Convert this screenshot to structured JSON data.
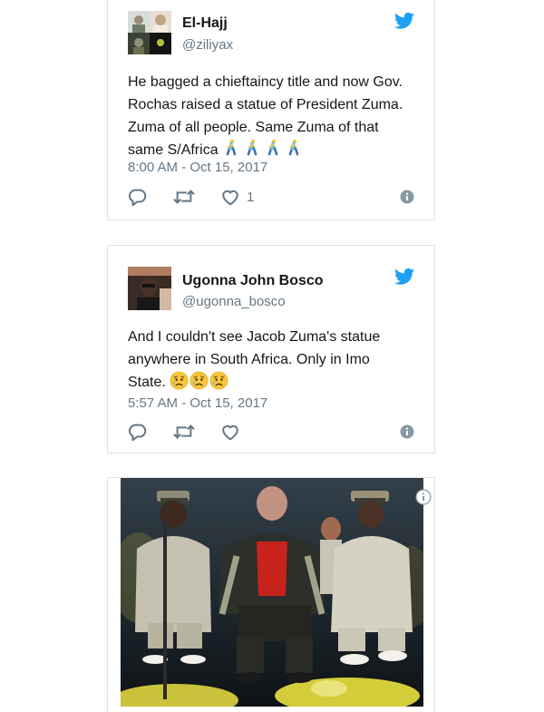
{
  "tweets": [
    {
      "display_name": "El-Hajj",
      "handle": "@ziliyax",
      "text_lines": [
        "He bagged a chieftaincy title and now  Gov.",
        "Rochas raised a statue of President Zuma.",
        "Zuma of all people. Same Zuma of that",
        "same S/Africa"
      ],
      "emojis": [
        "person-walking",
        "person-walking",
        "person-walking",
        "person-walking"
      ],
      "timestamp": "8:00 AM - Oct 15, 2017",
      "like_count": "1"
    },
    {
      "display_name": "Ugonna  John Bosco",
      "handle": "@ugonna_bosco",
      "text_lines": [
        "And I couldn't  see Jacob Zuma's  statue",
        "anywhere in South Africa. Only in Imo",
        "State."
      ],
      "emojis": [
        "disappointed-relieved-face",
        "disappointed-relieved-face",
        "disappointed-relieved-face"
      ],
      "timestamp": "5:57 AM - Oct 15, 2017",
      "like_count": ""
    }
  ],
  "icons": {
    "brand": "twitter-bird-icon",
    "reply": "reply-icon",
    "retweet": "retweet-icon",
    "like": "heart-icon",
    "info": "info-icon"
  },
  "colors": {
    "twitter_blue": "#1da1f2",
    "text": "#14171a",
    "muted": "#657786",
    "border": "#dfe3e6"
  }
}
